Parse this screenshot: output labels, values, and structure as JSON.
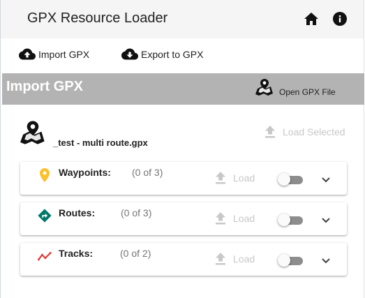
{
  "app": {
    "title": "GPX Resource Loader",
    "icons": {
      "home": "home-icon",
      "info": "info-icon"
    }
  },
  "toolbar": {
    "import_label": "Import GPX",
    "export_label": "Export to GPX",
    "import_icon": "cloud-upload-icon",
    "export_icon": "cloud-download-icon"
  },
  "section": {
    "title": "Import GPX",
    "open_file_label": "Open GPX File",
    "open_file_icon": "map-marker-icon"
  },
  "file": {
    "name": "_test - multi route.gpx",
    "icon": "map-marker-icon",
    "load_selected_label": "Load Selected",
    "load_selected_enabled": false
  },
  "resources": [
    {
      "label": "Waypoints:",
      "count": "(0 of 3)",
      "load_label": "Load",
      "icon": "location-pin-icon",
      "icon_color": "#fbc02d",
      "toggle_on": false
    },
    {
      "label": "Routes:",
      "count": "(0 of 3)",
      "load_label": "Load",
      "icon": "directions-icon",
      "icon_color": "#00796b",
      "toggle_on": false
    },
    {
      "label": "Tracks:",
      "count": "(0 of 2)",
      "load_label": "Load",
      "icon": "track-line-icon",
      "icon_color": "#e53935",
      "toggle_on": false
    }
  ],
  "colors": {
    "section_bar": "#b3b3b3",
    "disabled_text": "#c8c8c8",
    "appbar_bg": "#f5f5f5"
  }
}
